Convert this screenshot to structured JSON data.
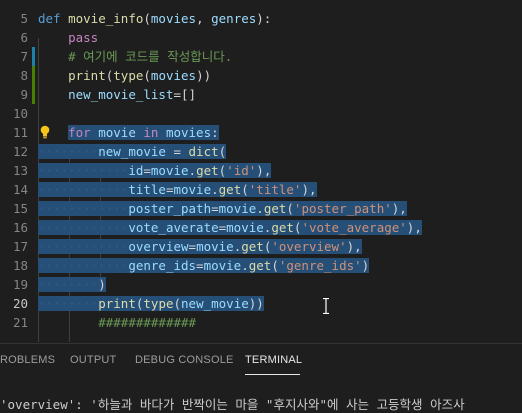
{
  "editor": {
    "lines": [
      {
        "num": "5",
        "tokens": [
          {
            "t": "def ",
            "c": "kw"
          },
          {
            "t": "movie_info",
            "c": "fn"
          },
          {
            "t": "(",
            "c": "pl"
          },
          {
            "t": "movies",
            "c": "var"
          },
          {
            "t": ", ",
            "c": "pl"
          },
          {
            "t": "genres",
            "c": "var"
          },
          {
            "t": "):",
            "c": "pl"
          }
        ]
      },
      {
        "num": "6",
        "tokens": [
          {
            "t": "    ",
            "c": "pl"
          },
          {
            "t": "pass",
            "c": "ctl"
          }
        ]
      },
      {
        "num": "7",
        "tokens": [
          {
            "t": "    ",
            "c": "pl"
          },
          {
            "t": "# 여기에 코드를 작성합니다.",
            "c": "cmt"
          }
        ]
      },
      {
        "num": "8",
        "tokens": [
          {
            "t": "    ",
            "c": "pl"
          },
          {
            "t": "print",
            "c": "fn"
          },
          {
            "t": "(",
            "c": "pl"
          },
          {
            "t": "type",
            "c": "fn"
          },
          {
            "t": "(",
            "c": "pl"
          },
          {
            "t": "movies",
            "c": "var"
          },
          {
            "t": "))",
            "c": "pl"
          }
        ]
      },
      {
        "num": "9",
        "tokens": [
          {
            "t": "    ",
            "c": "pl"
          },
          {
            "t": "new_movie_list",
            "c": "var"
          },
          {
            "t": "=[]",
            "c": "pl"
          }
        ]
      },
      {
        "num": "10",
        "tokens": []
      },
      {
        "num": "11",
        "tokens": [
          {
            "t": "    ",
            "c": "pl"
          },
          {
            "t": "for ",
            "c": "ctl"
          },
          {
            "t": "movie ",
            "c": "var"
          },
          {
            "t": "in ",
            "c": "ctl"
          },
          {
            "t": "movies",
            "c": "var"
          },
          {
            "t": ":",
            "c": "pl"
          }
        ]
      },
      {
        "num": "12",
        "tokens": [
          {
            "t": "········",
            "c": "ws"
          },
          {
            "t": "new_movie",
            "c": "var"
          },
          {
            "t": " = ",
            "c": "pl"
          },
          {
            "t": "dict",
            "c": "fn"
          },
          {
            "t": "(",
            "c": "pl"
          }
        ]
      },
      {
        "num": "13",
        "tokens": [
          {
            "t": "············",
            "c": "ws"
          },
          {
            "t": "id",
            "c": "var"
          },
          {
            "t": "=",
            "c": "pl"
          },
          {
            "t": "movie",
            "c": "var"
          },
          {
            "t": ".",
            "c": "pl"
          },
          {
            "t": "get",
            "c": "fn"
          },
          {
            "t": "(",
            "c": "pl"
          },
          {
            "t": "'id'",
            "c": "str"
          },
          {
            "t": "),",
            "c": "pl"
          }
        ]
      },
      {
        "num": "14",
        "tokens": [
          {
            "t": "············",
            "c": "ws"
          },
          {
            "t": "title",
            "c": "var"
          },
          {
            "t": "=",
            "c": "pl"
          },
          {
            "t": "movie",
            "c": "var"
          },
          {
            "t": ".",
            "c": "pl"
          },
          {
            "t": "get",
            "c": "fn"
          },
          {
            "t": "(",
            "c": "pl"
          },
          {
            "t": "'title'",
            "c": "str"
          },
          {
            "t": "),",
            "c": "pl"
          }
        ]
      },
      {
        "num": "15",
        "tokens": [
          {
            "t": "············",
            "c": "ws"
          },
          {
            "t": "poster_path",
            "c": "var"
          },
          {
            "t": "=",
            "c": "pl"
          },
          {
            "t": "movie",
            "c": "var"
          },
          {
            "t": ".",
            "c": "pl"
          },
          {
            "t": "get",
            "c": "fn"
          },
          {
            "t": "(",
            "c": "pl"
          },
          {
            "t": "'poster_path'",
            "c": "str"
          },
          {
            "t": "),",
            "c": "pl"
          }
        ]
      },
      {
        "num": "16",
        "tokens": [
          {
            "t": "············",
            "c": "ws"
          },
          {
            "t": "vote_averate",
            "c": "var"
          },
          {
            "t": "=",
            "c": "pl"
          },
          {
            "t": "movie",
            "c": "var"
          },
          {
            "t": ".",
            "c": "pl"
          },
          {
            "t": "get",
            "c": "fn"
          },
          {
            "t": "(",
            "c": "pl"
          },
          {
            "t": "'vote_average'",
            "c": "str"
          },
          {
            "t": "),",
            "c": "pl"
          }
        ]
      },
      {
        "num": "17",
        "tokens": [
          {
            "t": "············",
            "c": "ws"
          },
          {
            "t": "overview",
            "c": "var"
          },
          {
            "t": "=",
            "c": "pl"
          },
          {
            "t": "movie",
            "c": "var"
          },
          {
            "t": ".",
            "c": "pl"
          },
          {
            "t": "get",
            "c": "fn"
          },
          {
            "t": "(",
            "c": "pl"
          },
          {
            "t": "'overview'",
            "c": "str"
          },
          {
            "t": "),",
            "c": "pl"
          }
        ]
      },
      {
        "num": "18",
        "tokens": [
          {
            "t": "············",
            "c": "ws"
          },
          {
            "t": "genre_ids",
            "c": "var"
          },
          {
            "t": "=",
            "c": "pl"
          },
          {
            "t": "movie",
            "c": "var"
          },
          {
            "t": ".",
            "c": "pl"
          },
          {
            "t": "get",
            "c": "fn"
          },
          {
            "t": "(",
            "c": "pl"
          },
          {
            "t": "'genre_ids'",
            "c": "str"
          },
          {
            "t": ")",
            "c": "pl"
          }
        ]
      },
      {
        "num": "19",
        "tokens": [
          {
            "t": "········",
            "c": "ws"
          },
          {
            "t": ")",
            "c": "pl"
          }
        ]
      },
      {
        "num": "20",
        "tokens": [
          {
            "t": "········",
            "c": "ws"
          },
          {
            "t": "print",
            "c": "fn"
          },
          {
            "t": "(",
            "c": "pl"
          },
          {
            "t": "type",
            "c": "fn"
          },
          {
            "t": "(",
            "c": "pl"
          },
          {
            "t": "new_movie",
            "c": "var"
          },
          {
            "t": "))",
            "c": "pl"
          }
        ]
      },
      {
        "num": "21",
        "tokens": [
          {
            "t": "        ",
            "c": "pl"
          },
          {
            "t": "#############",
            "c": "cmt"
          }
        ]
      }
    ]
  },
  "panel": {
    "tabs": [
      {
        "label": "ROBLEMS",
        "active": false
      },
      {
        "label": "OUTPUT",
        "active": false
      },
      {
        "label": "DEBUG CONSOLE",
        "active": false
      },
      {
        "label": "TERMINAL",
        "active": true
      }
    ],
    "terminal_line": "'overview': '하늘과 바다가 반짝이는 마을 \"후지사와\"에 사는 고등학생 아즈사"
  },
  "icons": {
    "lightbulb": "lightbulb-icon",
    "text_cursor": "text-cursor-icon"
  },
  "colors": {
    "background": "#1e1e1e",
    "selection": "#264f78",
    "keyword": "#569cd6",
    "control": "#c586c0",
    "function": "#dcdcaa",
    "variable": "#9cdcfe",
    "string": "#ce9178",
    "comment": "#6a9955",
    "lightbulb": "#f5c518"
  }
}
